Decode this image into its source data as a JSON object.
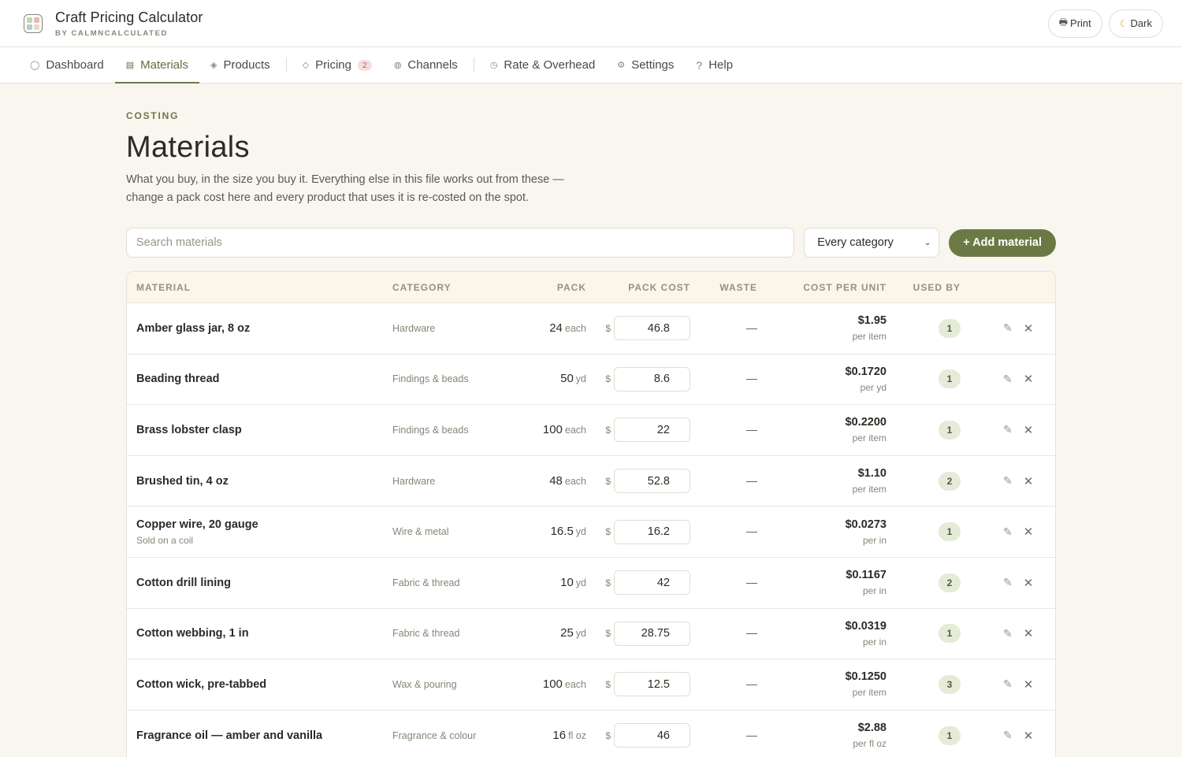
{
  "app": {
    "title": "Craft Pricing Calculator",
    "subtitle": "BY CALMNCALCULATED",
    "print_label": "Print",
    "dark_label": "Dark"
  },
  "tabs": [
    {
      "label": "Dashboard",
      "icon": "circle-icon"
    },
    {
      "label": "Materials",
      "icon": "list-icon"
    },
    {
      "label": "Products",
      "icon": "diamond-filled-icon"
    },
    {
      "label": "Pricing",
      "icon": "diamond-icon",
      "badge": "2"
    },
    {
      "label": "Channels",
      "icon": "globe-icon"
    },
    {
      "label": "Rate & Overhead",
      "icon": "clock-icon"
    },
    {
      "label": "Settings",
      "icon": "gear-icon"
    },
    {
      "label": "Help",
      "icon": "question-icon"
    }
  ],
  "page": {
    "eyebrow": "COSTING",
    "title": "Materials",
    "description": "What you buy, in the size you buy it. Everything else in this file works out from these — change a pack cost here and every product that uses it is re-costed on the spot."
  },
  "toolbar": {
    "search_placeholder": "Search materials",
    "category_selected": "Every category",
    "add_label": "+ Add material"
  },
  "columns": {
    "material": "MATERIAL",
    "category": "CATEGORY",
    "pack": "PACK",
    "pack_cost": "PACK COST",
    "waste": "WASTE",
    "cost_per_unit": "COST PER UNIT",
    "used_by": "USED BY"
  },
  "currency": "$",
  "materials": [
    {
      "name": "Amber glass jar, 8 oz",
      "note": "",
      "category": "Hardware",
      "pack_qty": "24",
      "pack_unit": "each",
      "pack_cost": "46.8",
      "waste": "—",
      "cost_per_unit": "$1.95",
      "per_unit": "per item",
      "used_by": "1"
    },
    {
      "name": "Beading thread",
      "note": "",
      "category": "Findings & beads",
      "pack_qty": "50",
      "pack_unit": "yd",
      "pack_cost": "8.6",
      "waste": "—",
      "cost_per_unit": "$0.1720",
      "per_unit": "per yd",
      "used_by": "1"
    },
    {
      "name": "Brass lobster clasp",
      "note": "",
      "category": "Findings & beads",
      "pack_qty": "100",
      "pack_unit": "each",
      "pack_cost": "22",
      "waste": "—",
      "cost_per_unit": "$0.2200",
      "per_unit": "per item",
      "used_by": "1"
    },
    {
      "name": "Brushed tin, 4 oz",
      "note": "",
      "category": "Hardware",
      "pack_qty": "48",
      "pack_unit": "each",
      "pack_cost": "52.8",
      "waste": "—",
      "cost_per_unit": "$1.10",
      "per_unit": "per item",
      "used_by": "2"
    },
    {
      "name": "Copper wire, 20 gauge",
      "note": "Sold on a coil",
      "category": "Wire & metal",
      "pack_qty": "16.5",
      "pack_unit": "yd",
      "pack_cost": "16.2",
      "waste": "—",
      "cost_per_unit": "$0.0273",
      "per_unit": "per in",
      "used_by": "1"
    },
    {
      "name": "Cotton drill lining",
      "note": "",
      "category": "Fabric & thread",
      "pack_qty": "10",
      "pack_unit": "yd",
      "pack_cost": "42",
      "waste": "—",
      "cost_per_unit": "$0.1167",
      "per_unit": "per in",
      "used_by": "2"
    },
    {
      "name": "Cotton webbing, 1 in",
      "note": "",
      "category": "Fabric & thread",
      "pack_qty": "25",
      "pack_unit": "yd",
      "pack_cost": "28.75",
      "waste": "—",
      "cost_per_unit": "$0.0319",
      "per_unit": "per in",
      "used_by": "1"
    },
    {
      "name": "Cotton wick, pre-tabbed",
      "note": "",
      "category": "Wax & pouring",
      "pack_qty": "100",
      "pack_unit": "each",
      "pack_cost": "12.5",
      "waste": "—",
      "cost_per_unit": "$0.1250",
      "per_unit": "per item",
      "used_by": "3"
    },
    {
      "name": "Fragrance oil — amber and vanilla",
      "note": "",
      "category": "Fragrance & colour",
      "pack_qty": "16",
      "pack_unit": "fl oz",
      "pack_cost": "46",
      "waste": "—",
      "cost_per_unit": "$2.88",
      "per_unit": "per fl oz",
      "used_by": "1"
    }
  ]
}
